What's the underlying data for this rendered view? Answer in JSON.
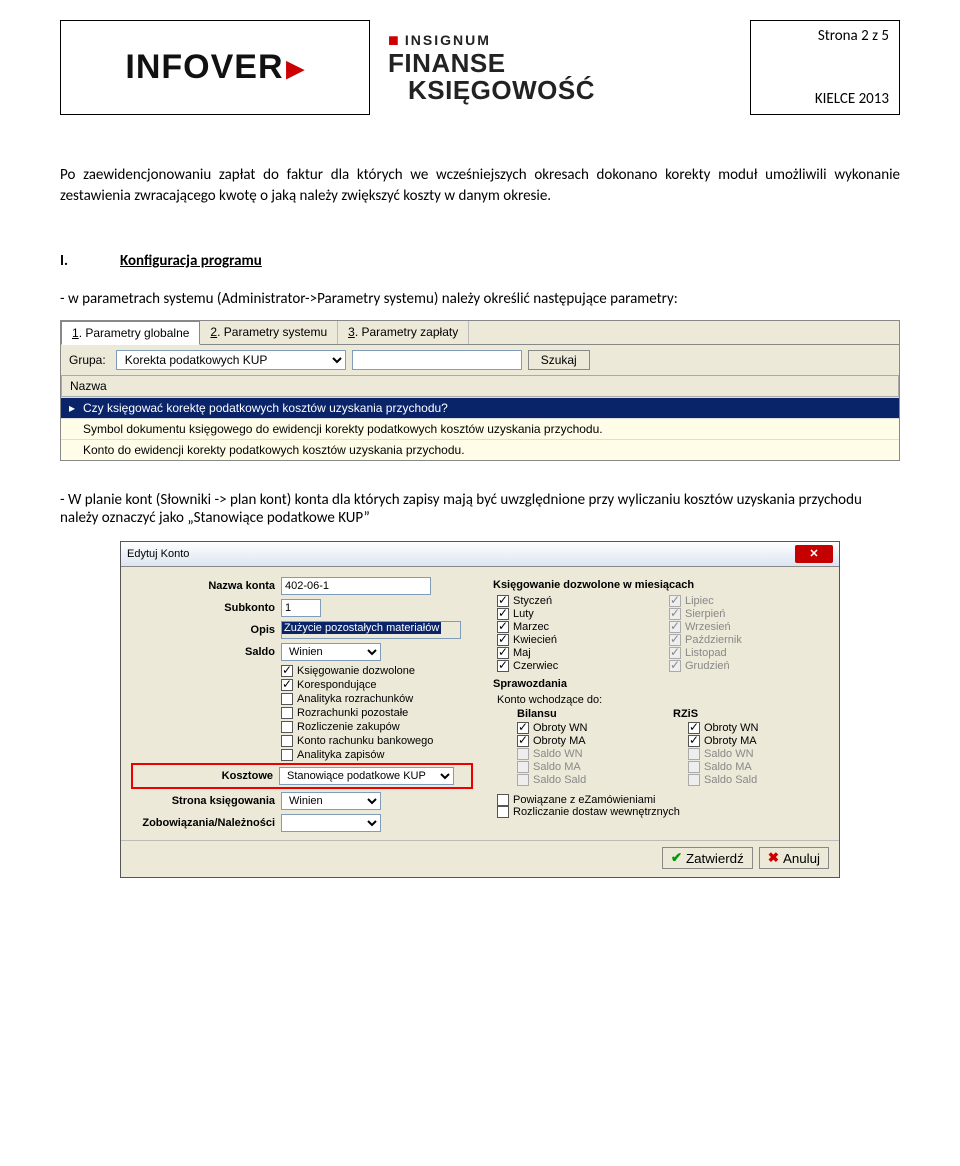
{
  "header": {
    "logo_text": "INFOVER",
    "insignum": "INSIGNUM",
    "line2": "FINANSE",
    "line3": "KSIĘGOWOŚĆ",
    "page_label": "Strona 2 z 5",
    "footer_label": "KIELCE 2013"
  },
  "body": {
    "para1": "Po zaewidencjonowaniu zapłat do faktur dla których we wcześniejszych okresach dokonano korekty moduł umożliwili wykonanie zestawienia zwracającego kwotę o jaką należy zwiększyć koszty w danym okresie.",
    "section_roman": "I.",
    "section_title": "Konfiguracja programu",
    "line1": "- w parametrach systemu (Administrator->Parametry systemu) należy określić następujące parametry:",
    "line2": "- W planie kont (Słowniki -> plan kont) konta dla których zapisy mają być uwzględnione przy wyliczaniu kosztów uzyskania przychodu należy oznaczyć jako „Stanowiące podatkowe KUP”"
  },
  "shot1": {
    "tabs": [
      "1. Parametry globalne",
      "2. Parametry systemu",
      "3. Parametry zapłaty"
    ],
    "active_tab": 0,
    "group_label": "Grupa:",
    "group_value": "Korekta podatkowych KUP",
    "search_value": "",
    "search_btn": "Szukaj",
    "col_header": "Nazwa",
    "rows": [
      "Czy księgować korektę podatkowych kosztów uzyskania przychodu?",
      "Symbol dokumentu księgowego do ewidencji korekty podatkowych kosztów uzyskania przychodu.",
      "Konto do ewidencji korekty podatkowych kosztów uzyskania przychodu."
    ],
    "selected_row": 0
  },
  "shot2": {
    "title": "Edytuj Konto",
    "fields": {
      "nazwa_label": "Nazwa konta",
      "nazwa_value": "402-06-1",
      "subkonto_label": "Subkonto",
      "subkonto_value": "1",
      "opis_label": "Opis",
      "opis_value": "Zużycie pozostałych materiałów",
      "saldo_label": "Saldo",
      "saldo_value": "Winien",
      "kosztowe_label": "Kosztowe",
      "kosztowe_value": "Stanowiące podatkowe KUP",
      "strona_label": "Strona księgowania",
      "strona_value": "Winien",
      "zobow_label": "Zobowiązania/Należności",
      "zobow_value": ""
    },
    "left_checks": [
      {
        "label": "Księgowanie dozwolone",
        "on": true
      },
      {
        "label": "Korespondujące",
        "on": true
      },
      {
        "label": "Analityka rozrachunków",
        "on": false
      },
      {
        "label": "Rozrachunki pozostałe",
        "on": false
      },
      {
        "label": "Rozliczenie zakupów",
        "on": false
      },
      {
        "label": "Konto rachunku bankowego",
        "on": false
      },
      {
        "label": "Analityka zapisów",
        "on": false
      }
    ],
    "months_title": "Księgowanie dozwolone w miesiącach",
    "months_left": [
      "Styczeń",
      "Luty",
      "Marzec",
      "Kwiecień",
      "Maj",
      "Czerwiec"
    ],
    "months_right": [
      "Lipiec",
      "Sierpień",
      "Wrzesień",
      "Październik",
      "Listopad",
      "Grudzień"
    ],
    "spraw_title": "Sprawozdania",
    "spraw_sub": "Konto wchodzące do:",
    "spraw_cols": [
      "Bilansu",
      "RZiS"
    ],
    "spraw_rows": [
      {
        "label": "Obroty WN",
        "l": true,
        "r": true
      },
      {
        "label": "Obroty MA",
        "l": true,
        "r": true
      },
      {
        "label": "Saldo WN",
        "l": false,
        "r": false,
        "disabled": true
      },
      {
        "label": "Saldo MA",
        "l": false,
        "r": false,
        "disabled": true
      },
      {
        "label": "Saldo Sald",
        "l": false,
        "r": false,
        "disabled": true
      }
    ],
    "extra_checks": [
      {
        "label": "Powiązane z eZamówieniami",
        "on": false
      },
      {
        "label": "Rozliczanie dostaw wewnętrznych",
        "on": false
      }
    ],
    "buttons": {
      "ok": "Zatwierdź",
      "cancel": "Anuluj"
    }
  }
}
